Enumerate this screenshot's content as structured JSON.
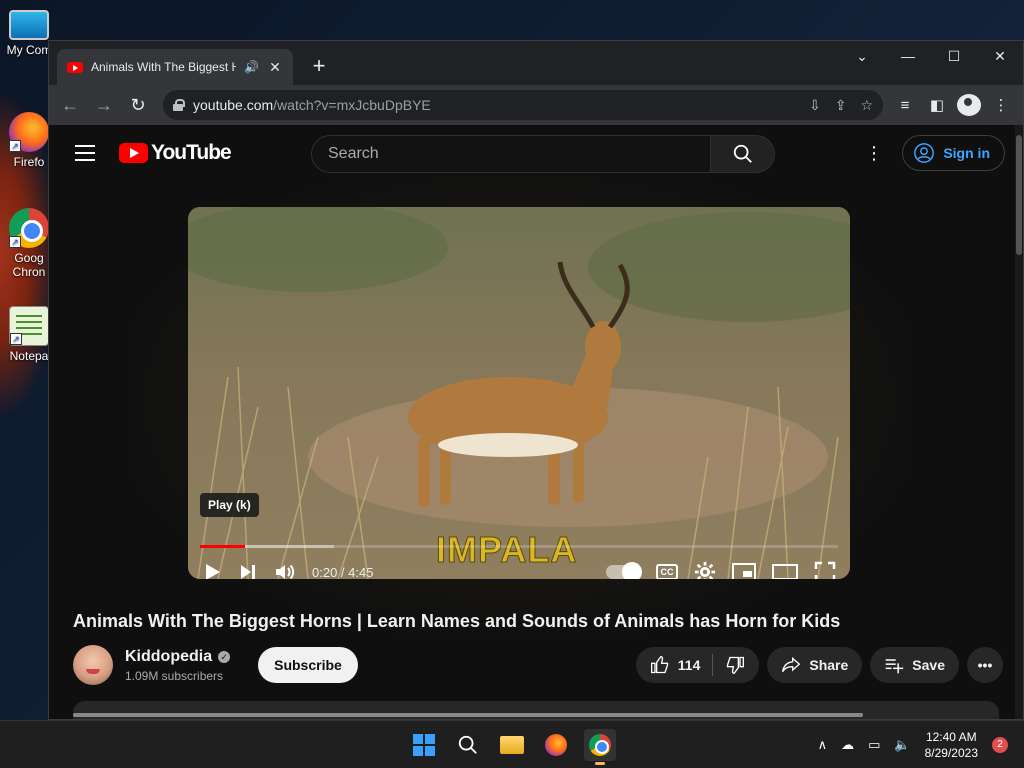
{
  "desktop": {
    "icons": [
      {
        "label": "My Com"
      },
      {
        "label": "Firefo"
      },
      {
        "label": "Goog Chron"
      },
      {
        "label": "Notepa"
      }
    ]
  },
  "browser": {
    "tab_title": "Animals With The Biggest Ho",
    "url_host": "youtube.com",
    "url_path": "/watch?v=mxJcbuDpBYE"
  },
  "youtube": {
    "logo_text": "YouTube",
    "search_placeholder": "Search",
    "sign_in": "Sign in",
    "player": {
      "tooltip": "Play (k)",
      "overlay_caption": "IMPALA",
      "current_time": "0:20",
      "duration": "4:45",
      "time_display": "0:20 / 4:45",
      "progress_fraction": 0.07,
      "buffered_fraction": 0.21
    },
    "video_title": "Animals With The Biggest Horns | Learn Names and Sounds of Animals has Horn for Kids",
    "channel_name": "Kiddopedia",
    "subscribers": "1.09M subscribers",
    "subscribe_label": "Subscribe",
    "likes": "114",
    "share_label": "Share",
    "save_label": "Save",
    "colors": {
      "accent_red": "#ff0000",
      "link_blue": "#3ea6ff"
    }
  },
  "taskbar": {
    "time": "12:40 AM",
    "date": "8/29/2023",
    "notification_count": "2"
  }
}
